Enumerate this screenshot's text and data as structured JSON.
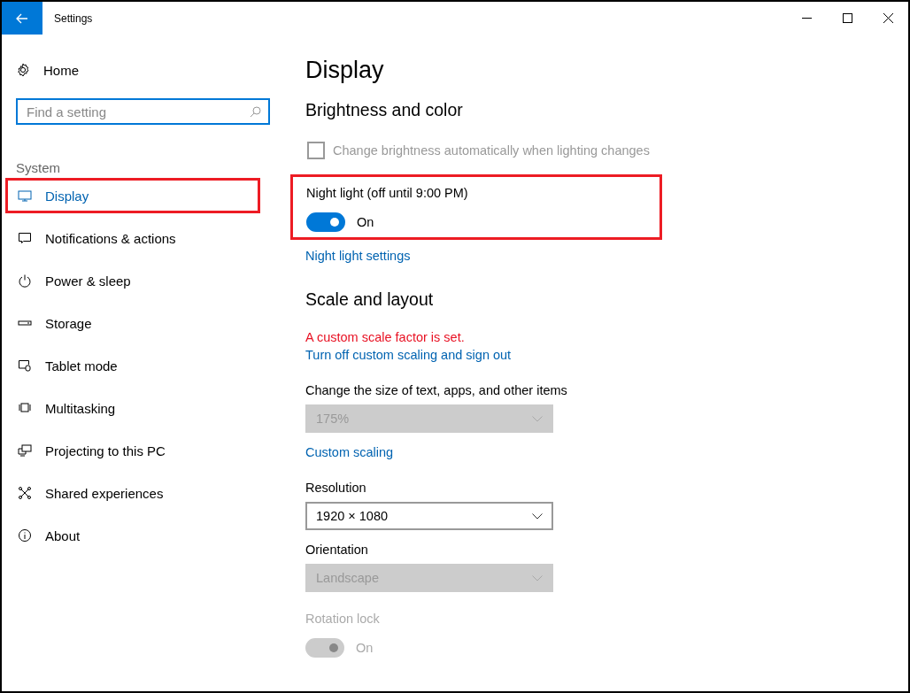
{
  "window": {
    "title": "Settings"
  },
  "sidebar": {
    "home": "Home",
    "search": {
      "placeholder": "Find a setting"
    },
    "group": "System",
    "items": [
      {
        "label": "Display",
        "selected": true,
        "highlighted": true
      },
      {
        "label": "Notifications & actions",
        "selected": false,
        "highlighted": false
      },
      {
        "label": "Power & sleep",
        "selected": false,
        "highlighted": false
      },
      {
        "label": "Storage",
        "selected": false,
        "highlighted": false
      },
      {
        "label": "Tablet mode",
        "selected": false,
        "highlighted": false
      },
      {
        "label": "Multitasking",
        "selected": false,
        "highlighted": false
      },
      {
        "label": "Projecting to this PC",
        "selected": false,
        "highlighted": false
      },
      {
        "label": "Shared experiences",
        "selected": false,
        "highlighted": false
      },
      {
        "label": "About",
        "selected": false,
        "highlighted": false
      }
    ]
  },
  "content": {
    "title": "Display",
    "sections": [
      {
        "heading": "Brightness and color",
        "controls": [
          {
            "kind": "checkbox",
            "label": "Change brightness automatically when lighting changes",
            "checked": false,
            "disabled": true
          },
          {
            "kind": "toggle",
            "label": "Night light (off until 9:00 PM)",
            "on": true,
            "state_text": "On",
            "disabled": false,
            "highlighted": true
          },
          {
            "kind": "link",
            "text": "Night light settings"
          }
        ]
      },
      {
        "heading": "Scale and layout",
        "controls": [
          {
            "kind": "warning",
            "text": "A custom scale factor is set."
          },
          {
            "kind": "link",
            "text": "Turn off custom scaling and sign out"
          },
          {
            "kind": "dropdown",
            "label": "Change the size of text, apps, and other items",
            "value": "175%",
            "disabled": true
          },
          {
            "kind": "link",
            "text": "Custom scaling"
          },
          {
            "kind": "dropdown",
            "label": "Resolution",
            "value": "1920 × 1080",
            "disabled": false
          },
          {
            "kind": "dropdown",
            "label": "Orientation",
            "value": "Landscape",
            "disabled": true
          },
          {
            "kind": "toggle",
            "label": "Rotation lock",
            "on": true,
            "state_text": "On",
            "disabled": true,
            "highlighted": false
          }
        ]
      }
    ]
  }
}
